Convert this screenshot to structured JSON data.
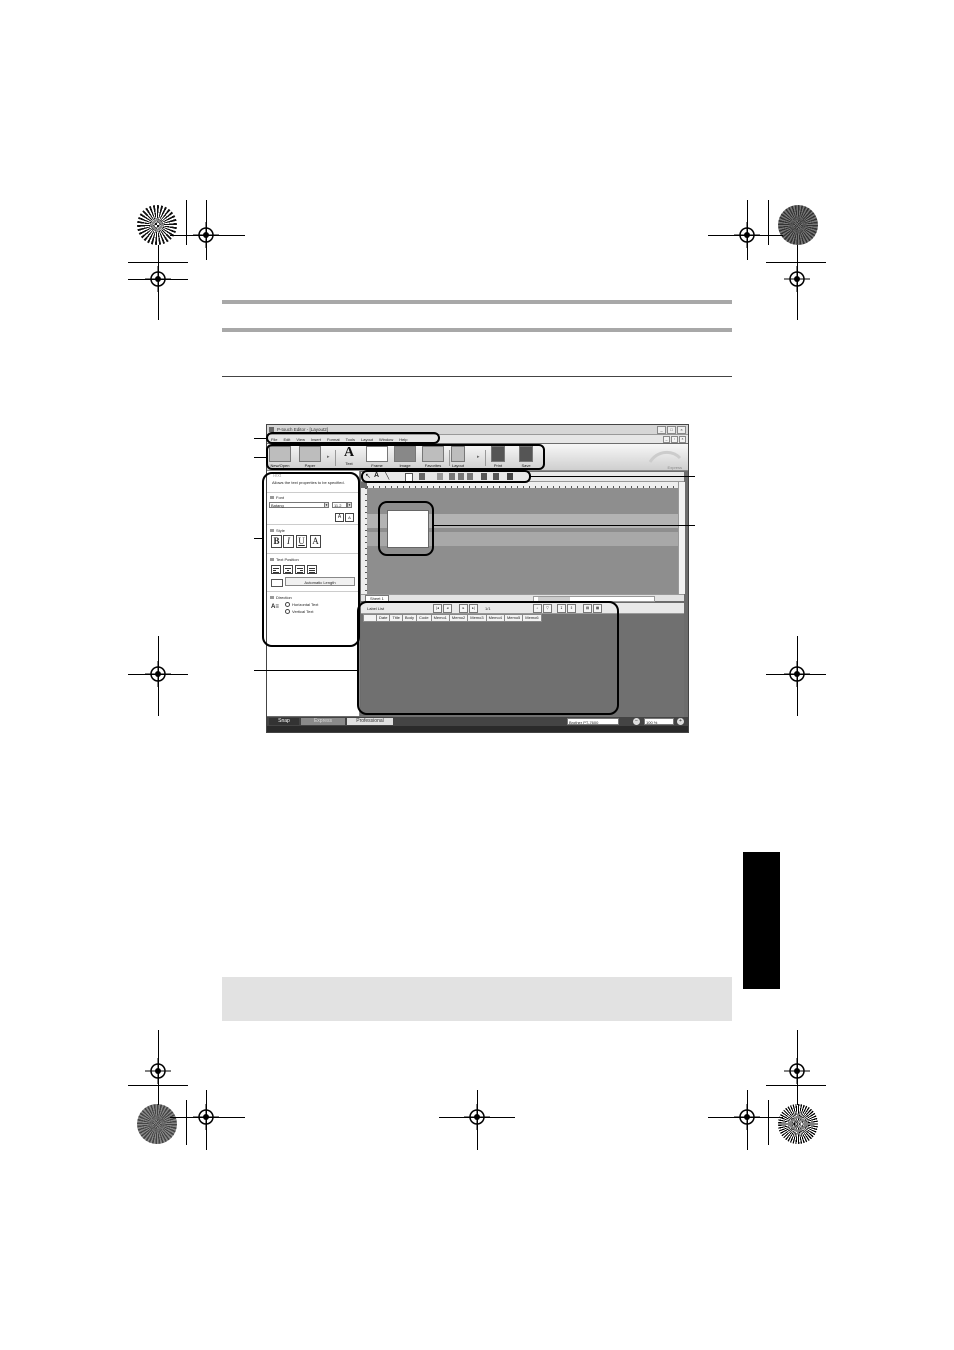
{
  "window": {
    "title": "P-touch Editor - [Layout2]",
    "controls": [
      "_",
      "□",
      "×"
    ],
    "mdi_controls": [
      "_",
      "▫",
      "×"
    ]
  },
  "menu": [
    "File",
    "Edit",
    "View",
    "Insert",
    "Format",
    "Tools",
    "Layout",
    "Window",
    "Help"
  ],
  "command_bar": {
    "items": [
      "New/Open",
      "Paper",
      "Text",
      "Frame",
      "Image",
      "Favorites",
      "Layout",
      "Print",
      "Save"
    ],
    "express_label": "Express"
  },
  "sidebar": {
    "title": "Text",
    "description": "Allows the text properties to be specified.",
    "font_section": "Font",
    "font_name": "Batang",
    "font_size": "11.2",
    "style_section": "Style",
    "style_buttons": [
      "B",
      "I",
      "U",
      "A"
    ],
    "text_position_section": "Text Position",
    "length_button": "Automatic Length",
    "direction_section": "Direction",
    "direction_options": [
      "Horizontal Text",
      "Vertical Text"
    ],
    "size_up": "A",
    "size_down": "A"
  },
  "editor": {
    "sheet_tab": "Sheet 1"
  },
  "label_list": {
    "title": "Label List",
    "record_count": "1/1",
    "columns": [
      "",
      "Date",
      "Title",
      "Body",
      "Code",
      "Memo1",
      "Memo2",
      "Memo3",
      "Memo4",
      "Memo5",
      "Memo6"
    ]
  },
  "statusbar": {
    "snap": "Snap",
    "express": "Express",
    "professional": "Professional",
    "printer": "Brother PT-7600",
    "zoom": "100 %"
  }
}
